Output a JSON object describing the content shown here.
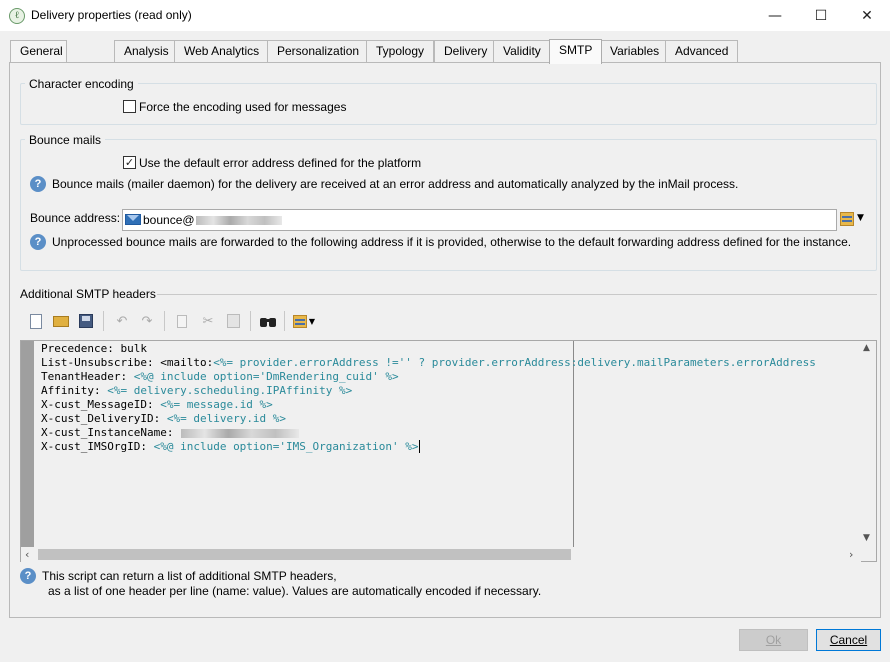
{
  "window": {
    "title": "Delivery properties (read only)",
    "minimize_glyph": "—",
    "maximize_glyph": "☐",
    "close_glyph": "✕"
  },
  "tabs": [
    {
      "label": "General"
    },
    {
      "label": "Analysis"
    },
    {
      "label": "Web Analytics"
    },
    {
      "label": "Personalization"
    },
    {
      "label": "Typology"
    },
    {
      "label": "Delivery"
    },
    {
      "label": "Validity"
    },
    {
      "label": "SMTP",
      "active": true
    },
    {
      "label": "Variables"
    },
    {
      "label": "Advanced"
    }
  ],
  "character_encoding": {
    "title": "Character encoding",
    "force_label": "Force the encoding used for messages",
    "force_checked": false
  },
  "bounce_mails": {
    "title": "Bounce mails",
    "use_default_label": "Use the default error address defined for the platform",
    "use_default_checked": true,
    "info_text": "Bounce mails (mailer daemon) for the delivery are received at an error address and automatically analyzed by the inMail process.",
    "address_label": "Bounce address:",
    "address_value": "bounce@",
    "forward_text": "Unprocessed bounce mails are forwarded to the following address if it is provided, otherwise to the default forwarding address defined for the instance."
  },
  "smtp_headers": {
    "title": "Additional SMTP headers",
    "toolbar_icons": [
      "new-file-icon",
      "open-folder-icon",
      "save-icon",
      "undo-icon",
      "redo-icon",
      "copy-icon",
      "cut-icon",
      "paste-icon",
      "find-icon",
      "insert-menu-icon"
    ],
    "lines": [
      {
        "plain": "Precedence: bulk",
        "script": ""
      },
      {
        "plain": "List-Unsubscribe: <mailto:",
        "script": "<%= provider.errorAddress !='' ? provider.errorAddress:delivery.mailParameters.errorAddress"
      },
      {
        "plain": "TenantHeader: ",
        "script": "<%@ include option='DmRendering_cuid' %>"
      },
      {
        "plain": "Affinity: ",
        "script": "<%= delivery.scheduling.IPAffinity %>"
      },
      {
        "plain": "X-cust_MessageID: ",
        "script": "<%= message.id %>"
      },
      {
        "plain": "X-cust_DeliveryID: ",
        "script": "<%= delivery.id %>"
      },
      {
        "plain": "X-cust_InstanceName: ",
        "script": ""
      },
      {
        "plain": "X-cust_IMSOrgID: ",
        "script": "<%@ include option='IMS_Organization' %>"
      }
    ],
    "footer_line1": "This script can return a list of additional SMTP headers,",
    "footer_line2": "as a list of one header per line (name: value). Values are automatically encoded if necessary."
  },
  "buttons": {
    "ok": "Ok",
    "cancel": "Cancel"
  },
  "colors": {
    "script": "#2a8a9a",
    "help_icon": "#5b8fc7",
    "primary_border": "#0078d7"
  }
}
